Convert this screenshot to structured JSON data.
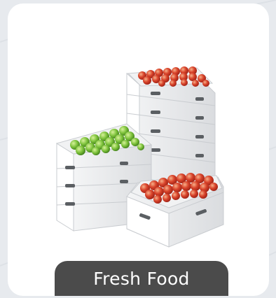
{
  "card": {
    "title": "Fresh Food",
    "image_subject": "stacked-white-produce-crates-icon",
    "colors": {
      "pill": "#4b4b4b",
      "card": "#ffffff",
      "background": "#e7eaee",
      "apple_red": "#d9442b",
      "apple_green": "#7cc13a"
    }
  }
}
